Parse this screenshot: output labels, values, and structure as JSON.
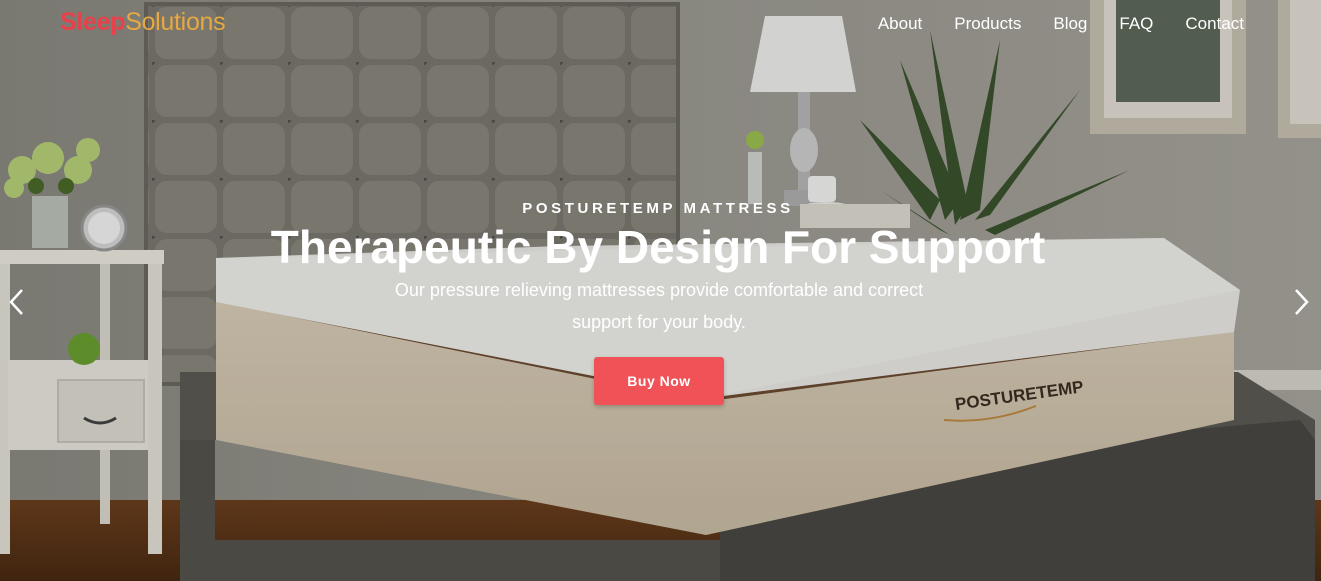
{
  "brand": {
    "part1": "Sleep",
    "part2": "Solutions"
  },
  "nav": {
    "items": [
      {
        "label": "About"
      },
      {
        "label": "Products"
      },
      {
        "label": "Blog"
      },
      {
        "label": "FAQ"
      },
      {
        "label": "Contact"
      }
    ]
  },
  "hero": {
    "eyebrow": "POSTURETEMP MATTRESS",
    "headline": "Therapeutic By Design For Support",
    "subtext_line1": "Our pressure relieving mattresses provide comfortable and correct",
    "subtext_line2": "support for your body.",
    "cta_label": "Buy Now",
    "mattress_brand_text": "POSTURETEMP",
    "prev_icon": "chevron-left-icon",
    "next_icon": "chevron-right-icon"
  },
  "colors": {
    "brand_primary": "#e8414a",
    "brand_secondary": "#e6a840",
    "button": "#f05257",
    "nav_text": "#ffffff"
  }
}
